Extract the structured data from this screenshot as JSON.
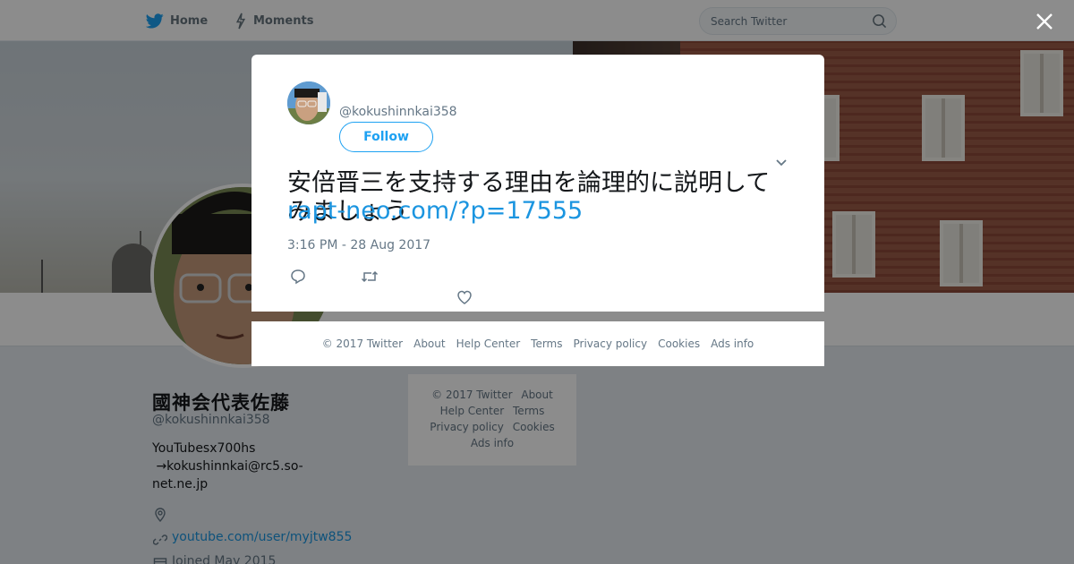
{
  "nav": {
    "home_label": "Home",
    "moments_label": "Moments",
    "search_placeholder": "Search Twitter"
  },
  "profile": {
    "name": "國神会代表佐藤",
    "handle": "@kokushinnkai358",
    "bio": "YouTubesx700hs\n →kokushinnkai@rc5.so-net.ne.jp",
    "url": "youtube.com/user/myjtw855",
    "joined": "Joined May 2015"
  },
  "side_footer": {
    "copyright": "© 2017 Twitter",
    "about": "About",
    "help": "Help Center",
    "terms": "Terms",
    "privacy": "Privacy policy",
    "cookies": "Cookies",
    "ads": "Ads info"
  },
  "tweet": {
    "handle": "@kokushinnkai358",
    "follow_label": "Follow",
    "text": "安倍晋三を支持する理由を論理的に説明してみましょう",
    "link": "rapt-neo.com/?p=17555",
    "timestamp": "3:16 PM - 28 Aug 2017"
  },
  "modal_footer": {
    "copyright": "© 2017 Twitter",
    "about": "About",
    "help": "Help Center",
    "terms": "Terms",
    "privacy": "Privacy policy",
    "cookies": "Cookies",
    "ads": "Ads info"
  },
  "colors": {
    "accent": "#1da1f2",
    "link": "#1b95e0",
    "muted": "#657786"
  },
  "icons": [
    "twitter-bird-icon",
    "lightning-icon",
    "search-icon",
    "close-icon",
    "chevron-down-icon",
    "reply-icon",
    "retweet-icon",
    "heart-icon",
    "location-icon",
    "link-icon",
    "calendar-icon"
  ]
}
